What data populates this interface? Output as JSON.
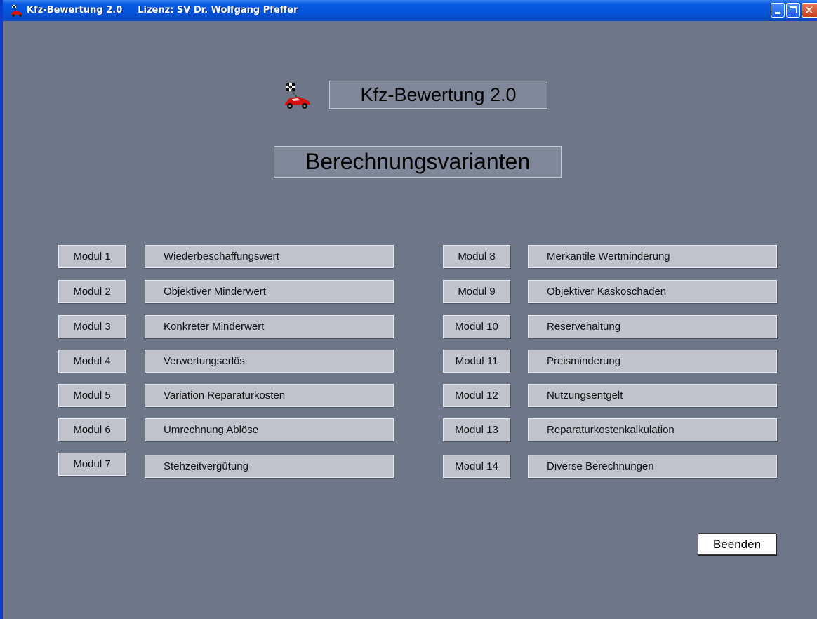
{
  "window": {
    "title": "Kfz-Bewertung 2.0",
    "license": "Lizenz: SV Dr. Wolfgang Pfeffer",
    "icon": "race-car-flag-icon",
    "controls": {
      "minimize": "minimize-icon",
      "maximize": "maximize-icon",
      "close": "✕"
    }
  },
  "header": {
    "app_heading": "Kfz-Bewertung 2.0",
    "section_heading": "Berechnungsvarianten",
    "logo_icon": "race-car-flag-icon"
  },
  "modules_left": [
    {
      "num": "Modul 1",
      "name": "Wiederbeschaffungswert"
    },
    {
      "num": "Modul 2",
      "name": "Objektiver Minderwert"
    },
    {
      "num": "Modul 3",
      "name": "Konkreter Minderwert"
    },
    {
      "num": "Modul 4",
      "name": "Verwertungserlös"
    },
    {
      "num": "Modul 5",
      "name": "Variation Reparaturkosten"
    },
    {
      "num": "Modul 6",
      "name": "Umrechnung Ablöse"
    },
    {
      "num": "Modul 7",
      "name": "Stehzeitvergütung"
    }
  ],
  "modules_right": [
    {
      "num": "Modul 8",
      "name": "Merkantile Wertminderung"
    },
    {
      "num": "Modul 9",
      "name": "Objektiver Kaskoschaden"
    },
    {
      "num": "Modul 10",
      "name": "Reservehaltung"
    },
    {
      "num": "Modul 11",
      "name": "Preisminderung"
    },
    {
      "num": "Modul 12",
      "name": "Nutzungsentgelt"
    },
    {
      "num": "Modul 13",
      "name": "Reparaturkostenkalkulation"
    },
    {
      "num": "Modul 14",
      "name": "Diverse Berechnungen"
    }
  ],
  "actions": {
    "exit_label": "Beenden"
  },
  "colors": {
    "background": "#6e7788",
    "titlebar": "#0453d8",
    "button_face": "#c0c3cc"
  }
}
